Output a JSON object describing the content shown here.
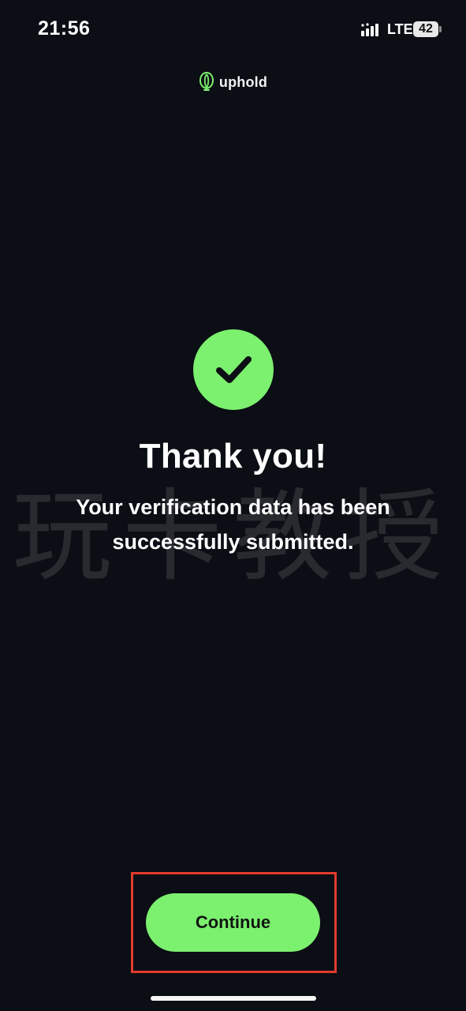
{
  "status_bar": {
    "time": "21:56",
    "network": "LTE",
    "battery_level": "42"
  },
  "brand": {
    "name": "uphold",
    "icon": "uphold-logo-icon",
    "color": "#7cf06f"
  },
  "success": {
    "icon": "checkmark-icon",
    "title": "Thank you!",
    "message": "Your verification data has been successfully submitted."
  },
  "watermark": {
    "text": "玩卡教授"
  },
  "actions": {
    "continue_label": "Continue"
  },
  "colors": {
    "background": "#0b0e14",
    "accent": "#7cf06f",
    "highlight": "#e23b2e"
  }
}
